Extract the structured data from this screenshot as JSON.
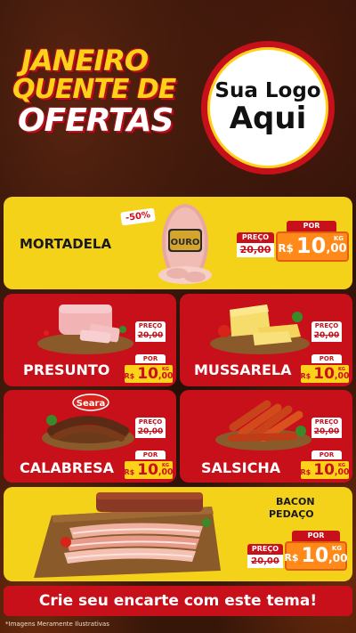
{
  "header": {
    "title_lines": [
      "JANEIRO",
      "QUENTE DE",
      "OFERTAS"
    ],
    "logo_line1": "Sua Logo",
    "logo_line2": "Aqui"
  },
  "labels": {
    "preco": "PREÇO",
    "por": "POR",
    "currency": "R$",
    "unit": "KG"
  },
  "products": {
    "mortadela": {
      "name": "MORTADELA",
      "discount": "-50%",
      "brand": "OURO",
      "old_price": "20,00",
      "price_int": "10",
      "price_cents": ",00"
    },
    "presunto": {
      "name": "PRESUNTO",
      "old_price": "20,00",
      "price_int": "10",
      "price_cents": ",00"
    },
    "mussarela": {
      "name": "MUSSARELA",
      "old_price": "20,00",
      "price_int": "10",
      "price_cents": ",00"
    },
    "calabresa": {
      "name": "CALABRESA",
      "brand": "Seara",
      "old_price": "20,00",
      "price_int": "10",
      "price_cents": ",00"
    },
    "salsicha": {
      "name": "SALSICHA",
      "old_price": "20,00",
      "price_int": "10",
      "price_cents": ",00"
    },
    "bacon": {
      "name_line1": "BACON",
      "name_line2": "PEDAÇO",
      "old_price": "20,00",
      "price_int": "10",
      "price_cents": ",00"
    }
  },
  "footer": {
    "cta": "Crie seu encarte com este tema!",
    "disclaimer": "*Imagens Meramente Ilustrativas"
  },
  "colors": {
    "red": "#c8101b",
    "yellow": "#f5d21a",
    "orange": "#ff8a1a",
    "background": "#1c0c07"
  }
}
